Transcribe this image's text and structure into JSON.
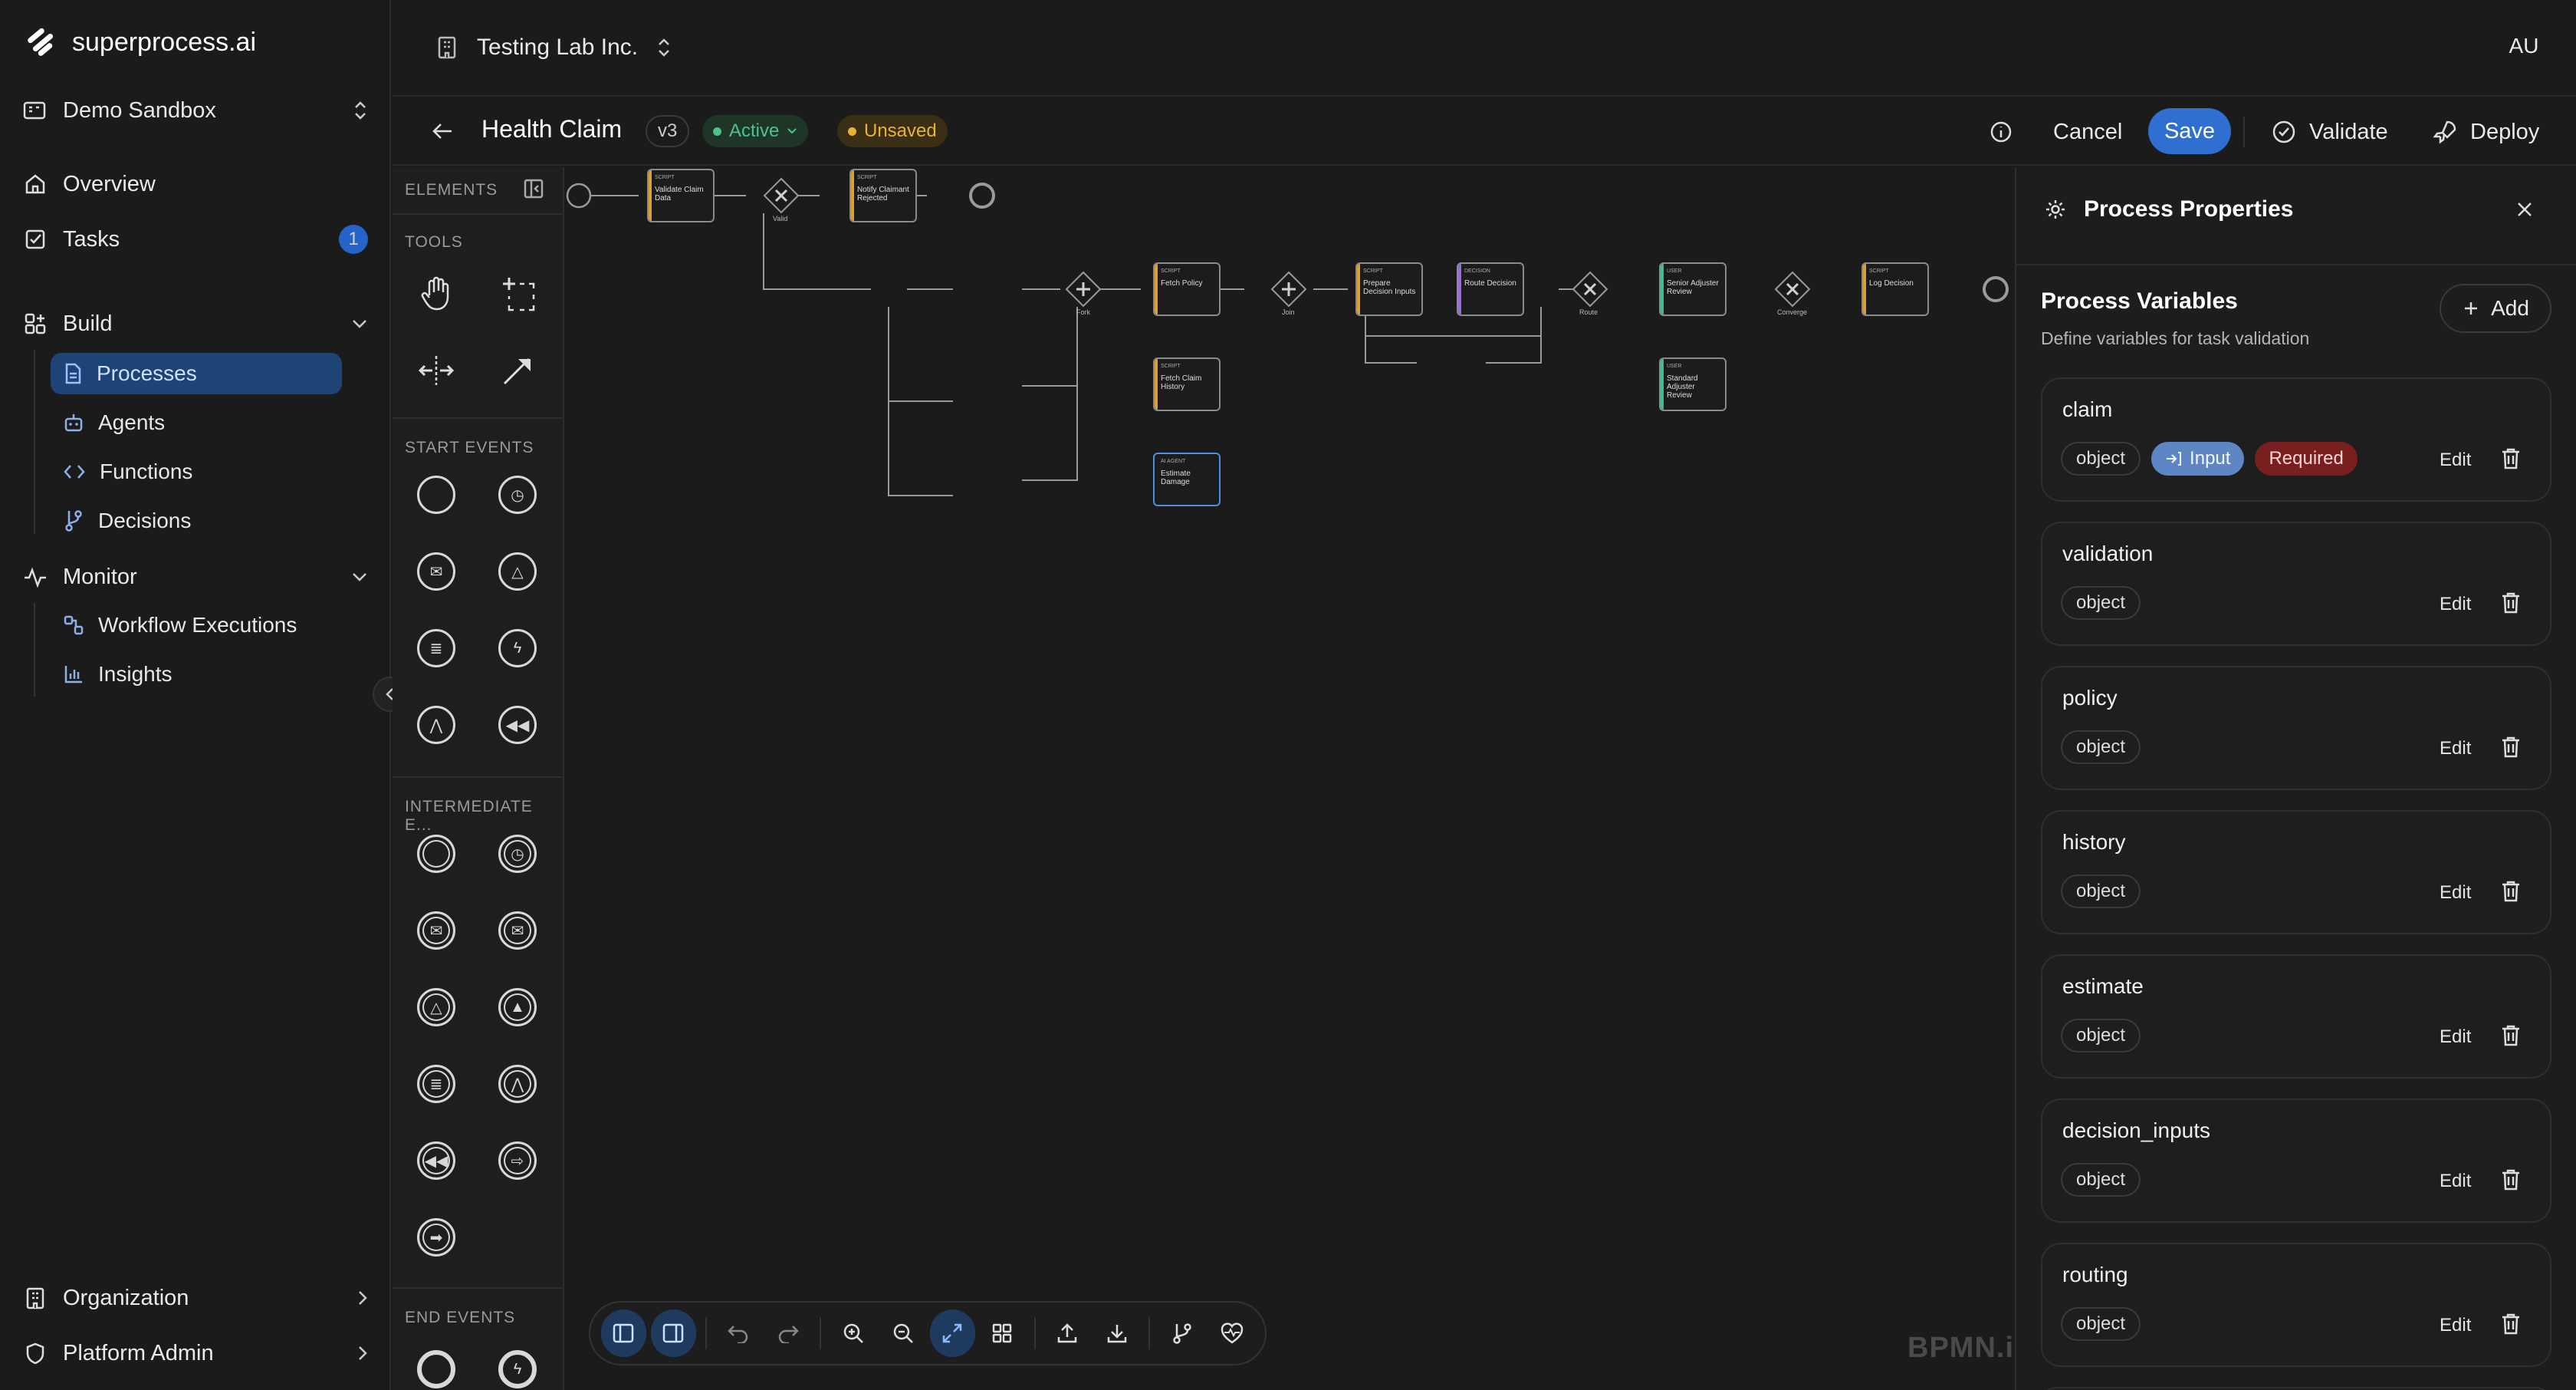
{
  "brand": {
    "name": "superprocess.ai"
  },
  "workspace": {
    "name": "Demo Sandbox"
  },
  "nav": {
    "overview": "Overview",
    "tasks": "Tasks",
    "tasks_badge": "1",
    "build": "Build",
    "processes": "Processes",
    "agents": "Agents",
    "functions": "Functions",
    "decisions": "Decisions",
    "monitor": "Monitor",
    "workflow_executions": "Workflow Executions",
    "insights": "Insights",
    "organization": "Organization",
    "platform_admin": "Platform Admin"
  },
  "topbar": {
    "org": "Testing Lab Inc.",
    "avatar": "AU"
  },
  "process": {
    "title": "Health Claim",
    "version": "v3",
    "status": "Active",
    "state": "Unsaved",
    "cancel": "Cancel",
    "save": "Save",
    "validate": "Validate",
    "deploy": "Deploy"
  },
  "palette": {
    "elements": "ELEMENTS",
    "tools": "TOOLS",
    "start_events": "START EVENTS",
    "intermediate_events": "INTERMEDIATE E...",
    "end_events": "END EVENTS"
  },
  "diagram": {
    "tasks": [
      {
        "type": "SCRIPT",
        "label": "Validate Claim Data",
        "color": "#e0a030"
      },
      {
        "type": "SCRIPT",
        "label": "Notify Claimant Rejected",
        "color": "#e0a030"
      },
      {
        "type": "SCRIPT",
        "label": "Fetch Policy",
        "color": "#e0a030"
      },
      {
        "type": "SCRIPT",
        "label": "Fetch Claim History",
        "color": "#e0a030"
      },
      {
        "type": "AI AGENT",
        "label": "Estimate Damage",
        "color": "#4f8fe0"
      },
      {
        "type": "SCRIPT",
        "label": "Prepare Decision Inputs",
        "color": "#e0a030"
      },
      {
        "type": "DECISION",
        "label": "Route Decision",
        "color": "#9a6be0"
      },
      {
        "type": "USER",
        "label": "Senior Adjuster Review",
        "color": "#3fbf8f"
      },
      {
        "type": "USER",
        "label": "Standard Adjuster Review",
        "color": "#3fbf8f"
      },
      {
        "type": "SCRIPT",
        "label": "Log Decision",
        "color": "#e0a030"
      }
    ],
    "gateways": [
      "Valid",
      "Fork",
      "Join",
      "Route",
      "Converge"
    ],
    "watermark": "BPMN.io"
  },
  "panel": {
    "title": "Process Properties",
    "vars_title": "Process Variables",
    "vars_subtitle": "Define variables for task validation",
    "add": "Add",
    "edit": "Edit",
    "variables": [
      {
        "name": "claim",
        "type": "object",
        "input": "Input",
        "required": "Required"
      },
      {
        "name": "validation",
        "type": "object"
      },
      {
        "name": "policy",
        "type": "object"
      },
      {
        "name": "history",
        "type": "object"
      },
      {
        "name": "estimate",
        "type": "object"
      },
      {
        "name": "decision_inputs",
        "type": "object"
      },
      {
        "name": "routing",
        "type": "object"
      }
    ]
  },
  "colors": {
    "accent": "#2f6fd0",
    "active": "#4cc38a",
    "unsaved": "#e9b237",
    "required": "#7a1f1f",
    "input": "#5f86c4"
  }
}
